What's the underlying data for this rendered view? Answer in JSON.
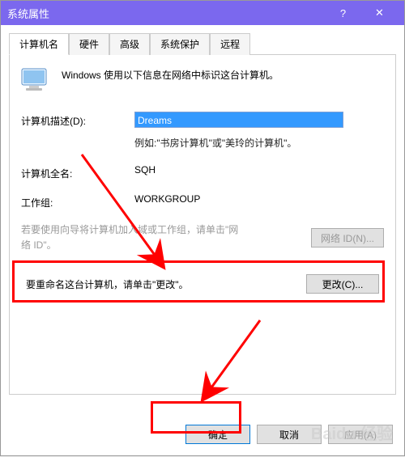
{
  "titlebar": {
    "title": "系统属性"
  },
  "tabs": {
    "computer_name": "计算机名",
    "hardware": "硬件",
    "advanced": "高级",
    "system_protection": "系统保护",
    "remote": "远程"
  },
  "intro": "Windows 使用以下信息在网络中标识这台计算机。",
  "fields": {
    "desc_label": "计算机描述(D):",
    "desc_value": "Dreams",
    "desc_hint": "例如:\"书房计算机\"或\"美玲的计算机\"。",
    "fullname_label": "计算机全名:",
    "fullname_value": "SQH",
    "workgroup_label": "工作组:",
    "workgroup_value": "WORKGROUP"
  },
  "domain_wizard_text": "若要使用向导将计算机加入域或工作组，请单击\"网络 ID\"。",
  "buttons": {
    "network_id": "网络 ID(N)...",
    "change": "更改(C)...",
    "ok": "确定",
    "cancel": "取消",
    "apply": "应用(A)"
  },
  "rename_text": "要重命名这台计算机，请单击\"更改\"。",
  "watermark": "Baidu 经验"
}
